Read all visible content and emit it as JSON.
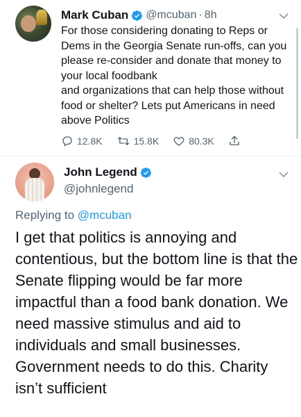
{
  "tweet1": {
    "author_name": "Mark Cuban",
    "author_handle": "@mcuban",
    "time_sep": "·",
    "time": "8h",
    "text": "For those considering donating to Reps or Dems in the Georgia Senate run-offs, can you please re-consider and donate that money to your local foodbank\n and organizations that can help those without food or shelter? Lets put Americans in need above Politics",
    "replies": "12.8K",
    "retweets": "15.8K",
    "likes": "80.3K"
  },
  "tweet2": {
    "author_name": "John Legend",
    "author_handle": "@johnlegend",
    "replying_label": "Replying to ",
    "replying_handle": "@mcuban",
    "text": "I get that politics is annoying and contentious, but the bottom line is that the Senate flipping would be far more impactful than a food bank donation. We need massive stimulus and aid to individuals and small businesses. Government needs to do this. Charity isn’t sufficient"
  },
  "icons": [
    "verified-icon",
    "chevron-down-icon",
    "reply-icon",
    "retweet-icon",
    "like-icon",
    "share-icon"
  ],
  "colors": {
    "accent": "#1d9bf0",
    "secondary_text": "#536471",
    "primary_text": "#0f1419"
  }
}
